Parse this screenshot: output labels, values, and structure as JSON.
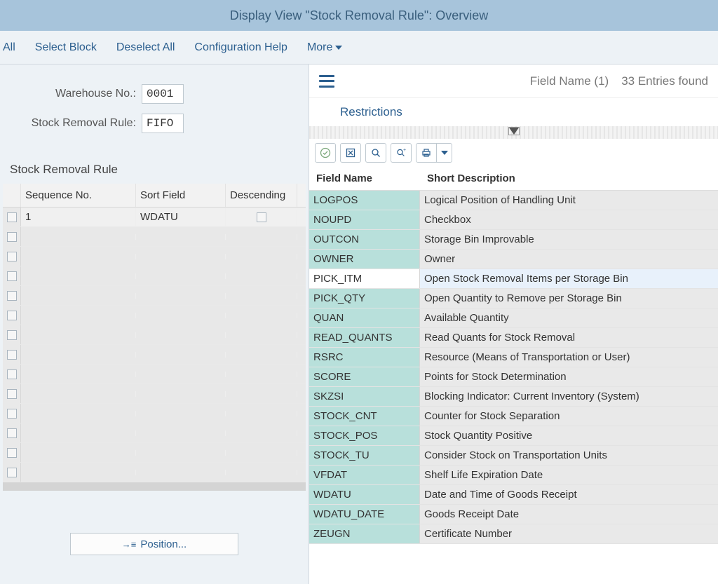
{
  "title": "Display View \"Stock Removal Rule\": Overview",
  "toolbar": {
    "all": "All",
    "select_block": "Select Block",
    "deselect_all": "Deselect All",
    "config_help": "Configuration Help",
    "more": "More"
  },
  "form": {
    "warehouse_label": "Warehouse No.:",
    "warehouse_value": "0001",
    "rule_label": "Stock Removal Rule:",
    "rule_value": "FIFO"
  },
  "section_title": "Stock Removal Rule",
  "grid": {
    "col_seq": "Sequence No.",
    "col_sort": "Sort Field",
    "col_desc": "Descending",
    "rows": [
      {
        "seq": "1",
        "sort": "WDATU",
        "desc": false
      }
    ]
  },
  "position_label": "Position...",
  "popup": {
    "field_name_count": "Field Name (1)",
    "entries_found": "33 Entries found",
    "restrictions": "Restrictions",
    "col_field": "Field Name",
    "col_short": "Short Description",
    "selected_field": "PICK_ITM",
    "rows": [
      {
        "f": "LOGPOS",
        "d": "Logical Position of Handling Unit"
      },
      {
        "f": "NOUPD",
        "d": "Checkbox"
      },
      {
        "f": "OUTCON",
        "d": "Storage Bin Improvable"
      },
      {
        "f": "OWNER",
        "d": "Owner"
      },
      {
        "f": "PICK_ITM",
        "d": "Open Stock Removal Items per Storage Bin"
      },
      {
        "f": "PICK_QTY",
        "d": "Open Quantity to Remove per Storage Bin"
      },
      {
        "f": "QUAN",
        "d": "Available Quantity"
      },
      {
        "f": "READ_QUANTS",
        "d": "Read Quants for Stock Removal"
      },
      {
        "f": "RSRC",
        "d": "Resource (Means of Transportation or User)"
      },
      {
        "f": "SCORE",
        "d": "Points for Stock Determination"
      },
      {
        "f": "SKZSI",
        "d": "Blocking Indicator: Current Inventory (System)"
      },
      {
        "f": "STOCK_CNT",
        "d": "Counter for Stock Separation"
      },
      {
        "f": "STOCK_POS",
        "d": "Stock Quantity Positive"
      },
      {
        "f": "STOCK_TU",
        "d": "Consider Stock on Transportation Units"
      },
      {
        "f": "VFDAT",
        "d": "Shelf Life Expiration Date"
      },
      {
        "f": "WDATU",
        "d": "Date and Time of Goods Receipt"
      },
      {
        "f": "WDATU_DATE",
        "d": "Goods Receipt Date"
      },
      {
        "f": "ZEUGN",
        "d": "Certificate Number"
      }
    ]
  }
}
